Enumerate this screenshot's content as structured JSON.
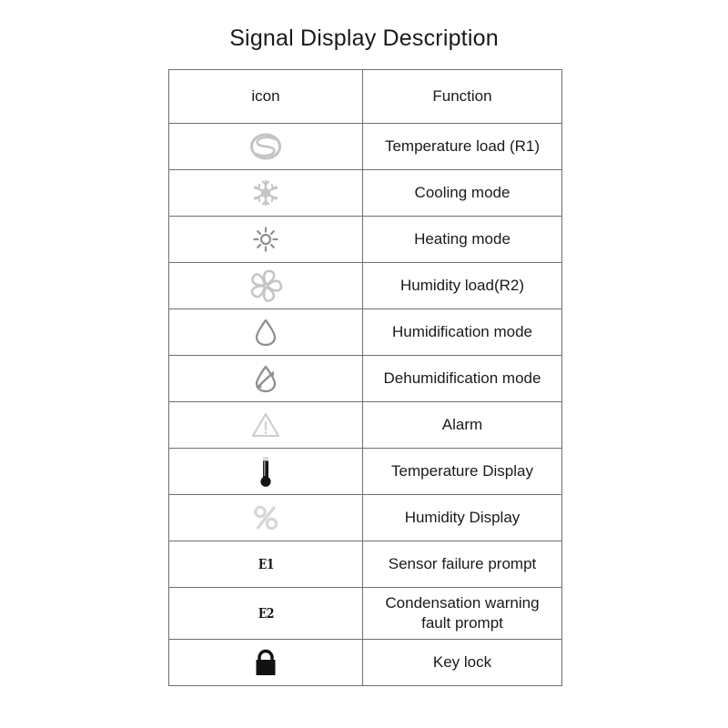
{
  "document": {
    "title": "Signal Display Description"
  },
  "table": {
    "headers": {
      "icon": "icon",
      "function": "Function"
    },
    "rows": [
      {
        "icon": "temperature-load-coil-icon",
        "icon_tone": "light",
        "function": "Temperature load (R1)"
      },
      {
        "icon": "snowflake-icon",
        "icon_tone": "light",
        "function": "Cooling mode"
      },
      {
        "icon": "sun-icon",
        "icon_tone": "medium",
        "function": "Heating mode"
      },
      {
        "icon": "fan-propeller-icon",
        "icon_tone": "light",
        "function": "Humidity load(R2)"
      },
      {
        "icon": "water-droplet-icon",
        "icon_tone": "medium",
        "function": "Humidification mode"
      },
      {
        "icon": "droplet-slash-icon",
        "icon_tone": "medium",
        "function": "Dehumidification mode"
      },
      {
        "icon": "warning-triangle-icon",
        "icon_tone": "light",
        "function": "Alarm"
      },
      {
        "icon": "thermometer-icon",
        "icon_tone": "dark",
        "function": "Temperature Display"
      },
      {
        "icon": "percent-icon",
        "icon_tone": "light",
        "function": "Humidity Display"
      },
      {
        "icon": "code-e1-icon",
        "icon_tone": "dark",
        "function": "Sensor failure prompt"
      },
      {
        "icon": "code-e2-icon",
        "icon_tone": "dark",
        "function": "Condensation warning",
        "function_line2": "fault prompt"
      },
      {
        "icon": "lock-icon",
        "icon_tone": "dark",
        "function": "Key lock"
      }
    ],
    "icon_labels": {
      "code_e1": "E1",
      "code_e2": "E2"
    }
  },
  "colors": {
    "border": "#6f6f6f",
    "text": "#1a1a1a",
    "icon_light": "#c9c9c9",
    "icon_medium": "#9a9a9a",
    "icon_dark": "#151515",
    "background": "#ffffff"
  }
}
